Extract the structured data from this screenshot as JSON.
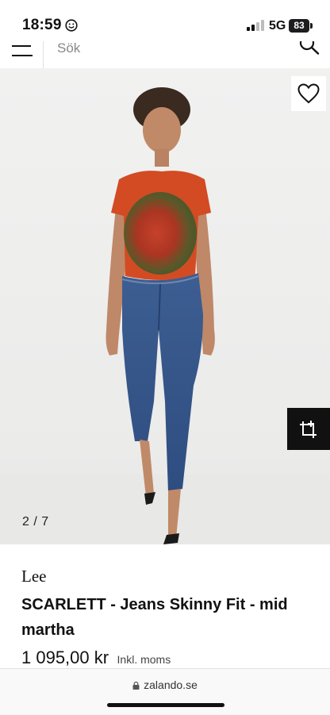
{
  "status_bar": {
    "time": "18:59",
    "network": "5G",
    "battery": "83"
  },
  "header": {
    "search_placeholder": "Sök"
  },
  "gallery": {
    "counter": "2 / 7"
  },
  "product": {
    "brand": "Lee",
    "name": "SCARLETT - Jeans Skinny Fit - mid martha",
    "price": "1 095,00 kr",
    "vat_note": "Inkl. moms"
  },
  "browser": {
    "url": "zalando.se"
  },
  "icons": [
    "smiley-icon",
    "signal-icon",
    "battery-icon",
    "menu-icon",
    "search-icon",
    "heart-icon",
    "ar-view-icon",
    "lock-icon"
  ]
}
